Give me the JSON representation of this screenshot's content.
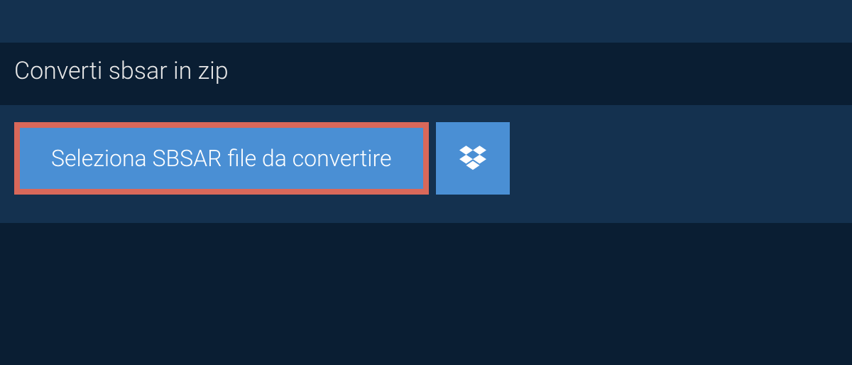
{
  "tab": {
    "title": "Converti sbsar in zip"
  },
  "buttons": {
    "select_file_label": "Seleziona SBSAR file da convertire"
  }
}
